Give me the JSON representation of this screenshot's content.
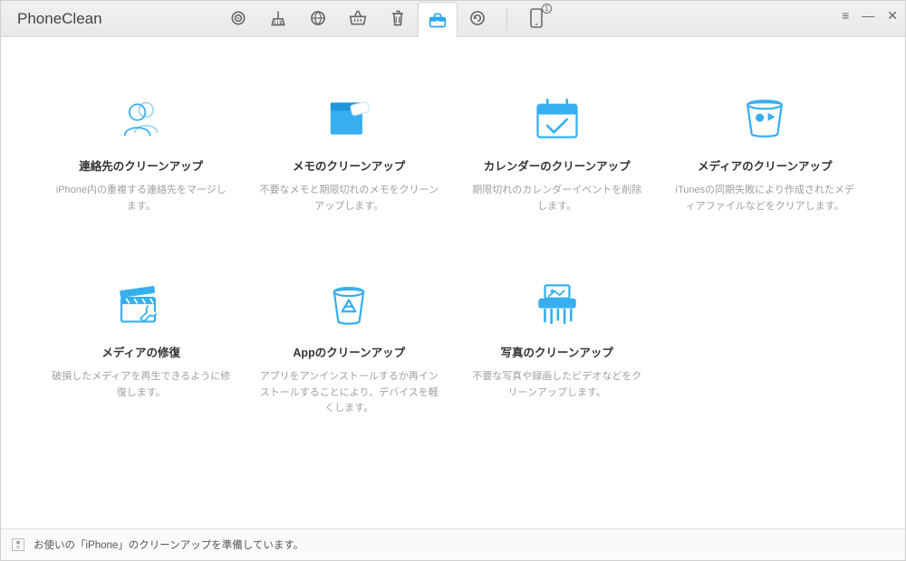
{
  "app": {
    "title": "PhoneClean"
  },
  "toolbar": {
    "items": [
      {
        "name": "home-icon",
        "selected": false
      },
      {
        "name": "brush-icon",
        "selected": false
      },
      {
        "name": "globe-icon",
        "selected": false
      },
      {
        "name": "basket-icon",
        "selected": false
      },
      {
        "name": "trash-icon",
        "selected": false
      },
      {
        "name": "toolbox-icon",
        "selected": true
      },
      {
        "name": "refresh-icon",
        "selected": false
      }
    ],
    "device_badge": 1
  },
  "features": [
    {
      "id": "contacts-cleanup",
      "title": "連絡先のクリーンアップ",
      "desc": "iPhone内の重複する連絡先をマージします。",
      "icon": "contacts"
    },
    {
      "id": "notes-cleanup",
      "title": "メモのクリーンアップ",
      "desc": "不要なメモと期限切れのメモをクリーンアップします。",
      "icon": "notes"
    },
    {
      "id": "calendar-cleanup",
      "title": "カレンダーのクリーンアップ",
      "desc": "期限切れのカレンダーイベントを削除します。",
      "icon": "calendar"
    },
    {
      "id": "media-cleanup",
      "title": "メディアのクリーンアップ",
      "desc": "iTunesの同期失敗により作成されたメディアファイルなどをクリアします。",
      "icon": "media-cup"
    },
    {
      "id": "media-repair",
      "title": "メディアの修復",
      "desc": "破損したメディアを再生できるように修復します。",
      "icon": "clapper"
    },
    {
      "id": "app-cleanup",
      "title": "Appのクリーンアップ",
      "desc": "アプリをアンインストールするか再インストールすることにより、デバイスを軽くします。",
      "icon": "app-trash"
    },
    {
      "id": "photo-cleanup",
      "title": "写真のクリーンアップ",
      "desc": "不要な写真や録画したビデオなどをクリーンアップします。",
      "icon": "shredder"
    }
  ],
  "status": {
    "text": "お使いの「iPhone」のクリーンアップを準備しています。"
  },
  "colors": {
    "accent": "#2aa7ee",
    "toolbar_icon": "#6a6a6a"
  }
}
